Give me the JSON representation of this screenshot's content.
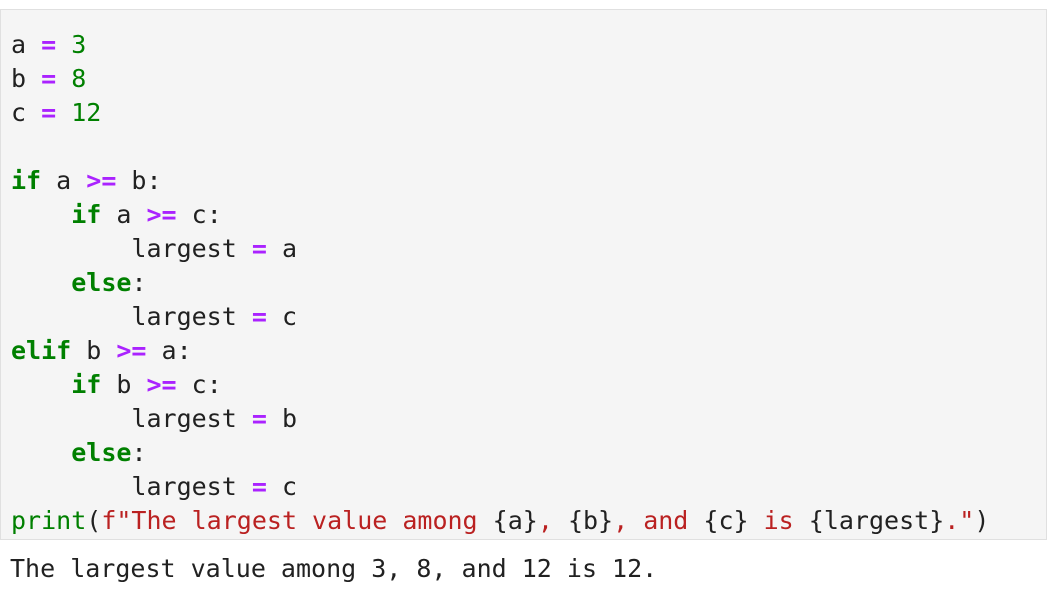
{
  "code_cell": {
    "lines": [
      [
        {
          "t": "a ",
          "c": ""
        },
        {
          "t": "=",
          "c": "op"
        },
        {
          "t": " ",
          "c": ""
        },
        {
          "t": "3",
          "c": "num"
        }
      ],
      [
        {
          "t": "b ",
          "c": ""
        },
        {
          "t": "=",
          "c": "op"
        },
        {
          "t": " ",
          "c": ""
        },
        {
          "t": "8",
          "c": "num"
        }
      ],
      [
        {
          "t": "c ",
          "c": ""
        },
        {
          "t": "=",
          "c": "op"
        },
        {
          "t": " ",
          "c": ""
        },
        {
          "t": "12",
          "c": "num"
        }
      ],
      [],
      [
        {
          "t": "if",
          "c": "kw"
        },
        {
          "t": " a ",
          "c": ""
        },
        {
          "t": ">=",
          "c": "op"
        },
        {
          "t": " b:",
          "c": ""
        }
      ],
      [
        {
          "t": "    ",
          "c": ""
        },
        {
          "t": "if",
          "c": "kw"
        },
        {
          "t": " a ",
          "c": ""
        },
        {
          "t": ">=",
          "c": "op"
        },
        {
          "t": " c:",
          "c": ""
        }
      ],
      [
        {
          "t": "        largest ",
          "c": ""
        },
        {
          "t": "=",
          "c": "op"
        },
        {
          "t": " a",
          "c": ""
        }
      ],
      [
        {
          "t": "    ",
          "c": ""
        },
        {
          "t": "else",
          "c": "kw"
        },
        {
          "t": ":",
          "c": ""
        }
      ],
      [
        {
          "t": "        largest ",
          "c": ""
        },
        {
          "t": "=",
          "c": "op"
        },
        {
          "t": " c",
          "c": ""
        }
      ],
      [
        {
          "t": "elif",
          "c": "kw"
        },
        {
          "t": " b ",
          "c": ""
        },
        {
          "t": ">=",
          "c": "op"
        },
        {
          "t": " a:",
          "c": ""
        }
      ],
      [
        {
          "t": "    ",
          "c": ""
        },
        {
          "t": "if",
          "c": "kw"
        },
        {
          "t": " b ",
          "c": ""
        },
        {
          "t": ">=",
          "c": "op"
        },
        {
          "t": " c:",
          "c": ""
        }
      ],
      [
        {
          "t": "        largest ",
          "c": ""
        },
        {
          "t": "=",
          "c": "op"
        },
        {
          "t": " b",
          "c": ""
        }
      ],
      [
        {
          "t": "    ",
          "c": ""
        },
        {
          "t": "else",
          "c": "kw"
        },
        {
          "t": ":",
          "c": ""
        }
      ],
      [
        {
          "t": "        largest ",
          "c": ""
        },
        {
          "t": "=",
          "c": "op"
        },
        {
          "t": " c",
          "c": ""
        }
      ],
      [
        {
          "t": "print",
          "c": "bi"
        },
        {
          "t": "(",
          "c": ""
        },
        {
          "t": "f\"The largest value among ",
          "c": "str"
        },
        {
          "t": "{a}",
          "c": "si"
        },
        {
          "t": ", ",
          "c": "str"
        },
        {
          "t": "{b}",
          "c": "si"
        },
        {
          "t": ", and ",
          "c": "str"
        },
        {
          "t": "{c}",
          "c": "si"
        },
        {
          "t": " is ",
          "c": "str"
        },
        {
          "t": "{largest}",
          "c": "si"
        },
        {
          "t": ".\"",
          "c": "str"
        },
        {
          "t": ")",
          "c": ""
        }
      ]
    ]
  },
  "output_cell": {
    "text": "The largest value among 3, 8, and 12 is 12."
  }
}
